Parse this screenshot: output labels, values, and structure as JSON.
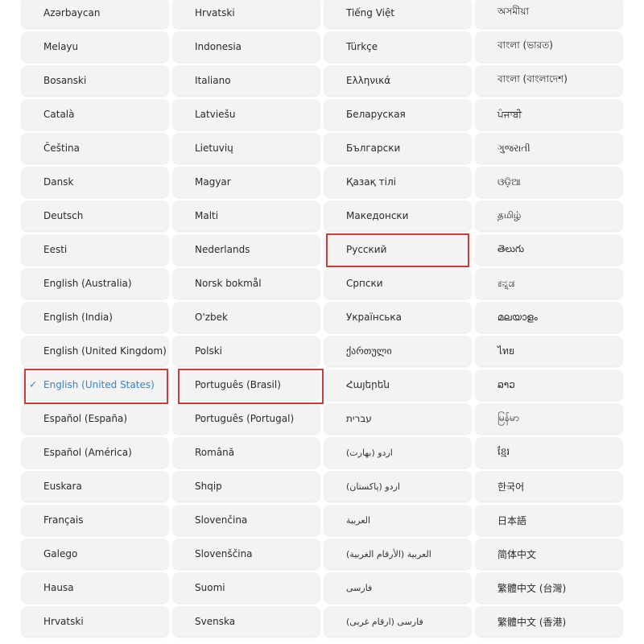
{
  "languages": {
    "c1": [
      "Azərbaycan",
      "Melayu",
      "Bosanski",
      "Català",
      "Čeština",
      "Dansk",
      "Deutsch",
      "Eesti",
      "English (Australia)",
      "English (India)",
      "English (United Kingdom)",
      "English (United States)",
      "Español (España)",
      "Español (América)",
      "Euskara",
      "Français",
      "Galego",
      "Hausa",
      "Hrvatski"
    ],
    "c2": [
      "Hrvatski",
      "Indonesia",
      "Italiano",
      "Latviešu",
      "Lietuvių",
      "Magyar",
      "Malti",
      "Nederlands",
      "Norsk bokmål",
      "O'zbek",
      "Polski",
      "Português (Brasil)",
      "Português (Portugal)",
      "Română",
      "Shqip",
      "Slovenčina",
      "Slovenščina",
      "Suomi",
      "Svenska"
    ],
    "c3": [
      "Tiếng Việt",
      "Türkçe",
      "Ελληνικά",
      "Беларуская",
      "Български",
      "Қазақ тілі",
      "Македонски",
      "Русский",
      "Српски",
      "Українська",
      "ქართული",
      "Հայերեն",
      "עברית",
      "اردو (بھارت)",
      "اردو (پاکستان)",
      "العربية",
      "العربية (الأرقام الغربية)",
      "فارسی",
      "فارسی (ارقام غربی)"
    ],
    "c4": [
      "অসমীয়া",
      "বাংলা (ভারত)",
      "বাংলা (বাংলাদেশ)",
      "ਪੰਜਾਬੀ",
      "ગુજરાતી",
      "ଓଡ଼ିଆ",
      "தமிழ்",
      "తెలుగు",
      "ಕನ್ನಡ",
      "മലയാളം",
      "ไทย",
      "ລາວ",
      "မြန်မာ",
      "ខ្មែរ",
      "한국어",
      "日本語",
      "简体中文",
      "繁體中文 (台灣)",
      "繁體中文 (香港)"
    ]
  },
  "selected_language": "English (United States)",
  "check_mark": "✓",
  "highlighted": [
    "English (United States)",
    "Português (Brasil)",
    "Русский"
  ],
  "colors": {
    "cell_bg": "#f3f3f4",
    "text": "#2a2a2a",
    "selected": "#2f86d6",
    "highlight_border": "#d23a3a"
  }
}
